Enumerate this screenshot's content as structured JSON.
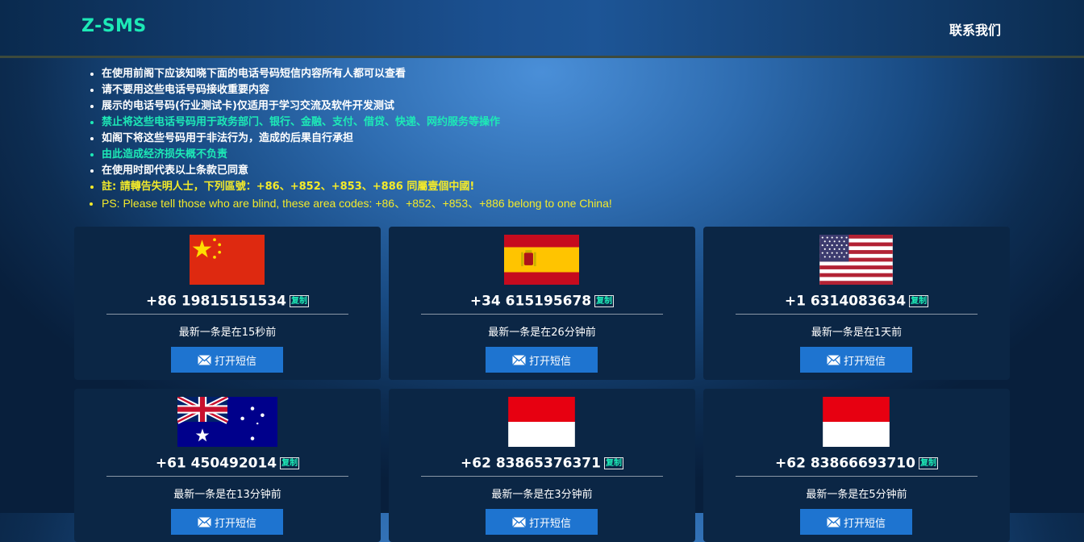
{
  "header": {
    "logo": "Z-SMS",
    "contact_link": "联系我们"
  },
  "notices": [
    "在使用前阁下应该知晓下面的电话号码短信内容所有人都可以查看",
    "请不要用这些电话号码接收重要内容",
    "展示的电话号码(行业测试卡)仅适用于学习交流及软件开发测试",
    "禁止将这些电话号码用于政务部门、银行、金融、支付、借贷、快递、网约服务等操作",
    "如阁下将这些号码用于非法行为，造成的后果自行承担",
    "由此造成经济损失概不负责",
    "在使用时即代表以上条款已同意",
    "註: 請轉告失明人士，下列區號：+86、+852、+853、+886 同屬壹個中國!",
    "PS: Please tell those who are blind, these area codes: +86、+852、+853、+886 belong to one China!"
  ],
  "copy_label": "复制",
  "open_label": "打开短信",
  "cards": [
    {
      "flag": "china-flag",
      "number": "+86 19815151534",
      "latest": "最新一条是在15秒前"
    },
    {
      "flag": "spain-flag",
      "number": "+34 615195678",
      "latest": "最新一条是在26分钟前"
    },
    {
      "flag": "usa-flag",
      "number": "+1 6314083634",
      "latest": "最新一条是在1天前"
    },
    {
      "flag": "australia-flag",
      "number": "+61 450492014",
      "latest": "最新一条是在13分钟前"
    },
    {
      "flag": "indonesia-flag",
      "number": "+62 83865376371",
      "latest": "最新一条是在3分钟前"
    },
    {
      "flag": "indonesia-flag",
      "number": "+62 83866693710",
      "latest": "最新一条是在5分钟前"
    }
  ]
}
